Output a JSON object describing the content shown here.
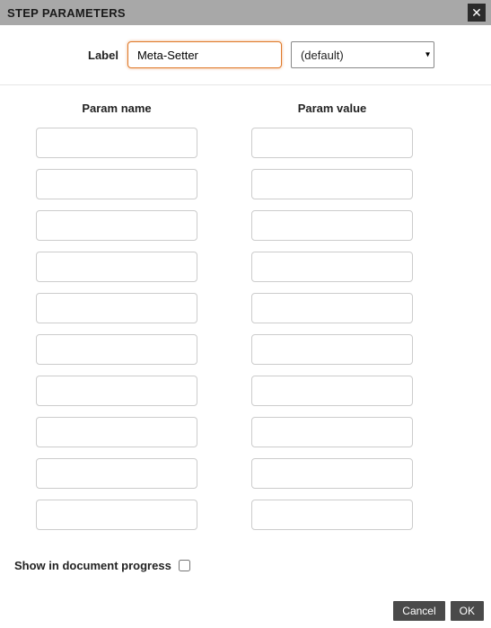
{
  "titlebar": {
    "title": "STEP PARAMETERS"
  },
  "label_row": {
    "label_text": "Label",
    "input_value": "Meta-Setter",
    "select_value": "(default)"
  },
  "columns": {
    "name_header": "Param name",
    "value_header": "Param value",
    "rows": [
      {
        "name": "",
        "value": ""
      },
      {
        "name": "",
        "value": ""
      },
      {
        "name": "",
        "value": ""
      },
      {
        "name": "",
        "value": ""
      },
      {
        "name": "",
        "value": ""
      },
      {
        "name": "",
        "value": ""
      },
      {
        "name": "",
        "value": ""
      },
      {
        "name": "",
        "value": ""
      },
      {
        "name": "",
        "value": ""
      },
      {
        "name": "",
        "value": ""
      }
    ]
  },
  "show_progress": {
    "label": "Show in document progress",
    "checked": false
  },
  "footer": {
    "cancel": "Cancel",
    "ok": "OK"
  }
}
